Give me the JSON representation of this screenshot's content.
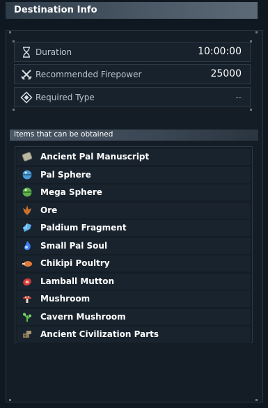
{
  "header": {
    "title": "Destination Info"
  },
  "stats": [
    {
      "label": "Duration",
      "value": "10:00:00",
      "icon": "hourglass-icon"
    },
    {
      "label": "Recommended Firepower",
      "value": "25000",
      "icon": "crossed-swords-icon"
    },
    {
      "label": "Required Type",
      "value": "--",
      "icon": "diamond-icon"
    }
  ],
  "items_section": {
    "title": "Items that can be obtained",
    "items": [
      {
        "label": "Ancient Pal Manuscript",
        "icon": "manuscript-icon"
      },
      {
        "label": "Pal Sphere",
        "icon": "pal-sphere-icon"
      },
      {
        "label": "Mega Sphere",
        "icon": "mega-sphere-icon"
      },
      {
        "label": "Ore",
        "icon": "ore-icon"
      },
      {
        "label": "Paldium Fragment",
        "icon": "paldium-fragment-icon"
      },
      {
        "label": "Small Pal Soul",
        "icon": "pal-soul-icon"
      },
      {
        "label": "Chikipi Poultry",
        "icon": "poultry-icon"
      },
      {
        "label": "Lamball Mutton",
        "icon": "mutton-icon"
      },
      {
        "label": "Mushroom",
        "icon": "mushroom-icon"
      },
      {
        "label": "Cavern Mushroom",
        "icon": "cavern-mushroom-icon"
      },
      {
        "label": "Ancient Civilization Parts",
        "icon": "ancient-parts-icon"
      }
    ]
  }
}
